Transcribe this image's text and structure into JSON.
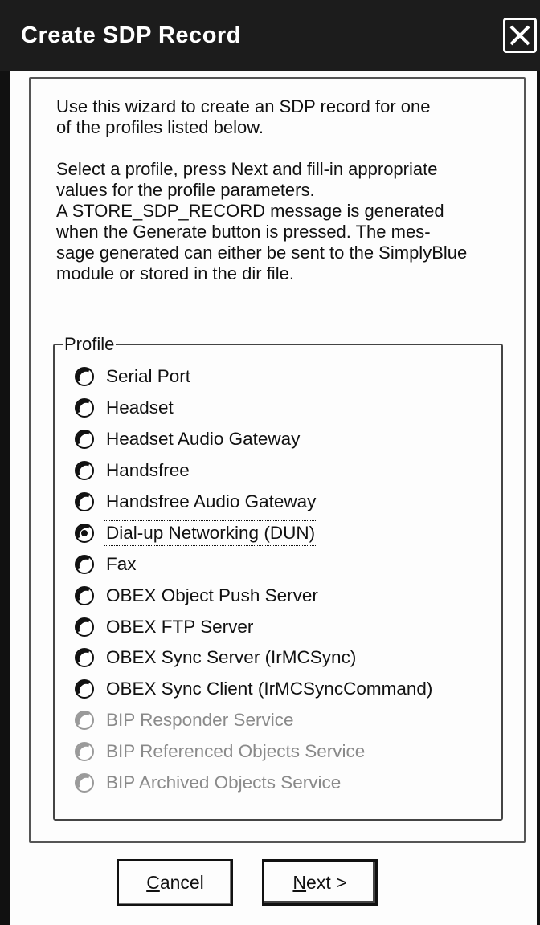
{
  "window": {
    "title": "Create SDP Record"
  },
  "intro": {
    "paragraph1": "Use this wizard to create an SDP record for one\nof the profiles listed below.",
    "paragraph2": "Select a profile, press Next and fill-in appropriate\nvalues for the profile parameters.\nA STORE_SDP_RECORD message is generated\nwhen the Generate button is pressed. The mes-\nsage generated can either be sent to the SimplyBlue\nmodule or stored in the dir file."
  },
  "profile_group": {
    "legend": "Profile",
    "options": [
      {
        "label": "Serial Port",
        "selected": false,
        "enabled": true
      },
      {
        "label": "Headset",
        "selected": false,
        "enabled": true
      },
      {
        "label": "Headset Audio Gateway",
        "selected": false,
        "enabled": true
      },
      {
        "label": "Handsfree",
        "selected": false,
        "enabled": true
      },
      {
        "label": "Handsfree Audio Gateway",
        "selected": false,
        "enabled": true
      },
      {
        "label": "Dial-up Networking (DUN)",
        "selected": true,
        "enabled": true
      },
      {
        "label": "Fax",
        "selected": false,
        "enabled": true
      },
      {
        "label": "OBEX Object Push Server",
        "selected": false,
        "enabled": true
      },
      {
        "label": "OBEX FTP Server",
        "selected": false,
        "enabled": true
      },
      {
        "label": "OBEX Sync Server (IrMCSync)",
        "selected": false,
        "enabled": true
      },
      {
        "label": "OBEX Sync Client (IrMCSyncCommand)",
        "selected": false,
        "enabled": true
      },
      {
        "label": "BIP Responder Service",
        "selected": false,
        "enabled": false
      },
      {
        "label": "BIP Referenced Objects Service",
        "selected": false,
        "enabled": false
      },
      {
        "label": "BIP Archived Objects Service",
        "selected": false,
        "enabled": false
      }
    ]
  },
  "buttons": {
    "cancel": {
      "mnemonic": "C",
      "rest": "ancel"
    },
    "next": {
      "mnemonic": "N",
      "rest": "ext >"
    }
  },
  "icons": {
    "close": "close-x-icon",
    "radio": "radio-button-icon"
  },
  "colors": {
    "titlebar": "#1c1c1c",
    "title_text": "#ffffff",
    "disabled_text": "#8a8a8a"
  }
}
